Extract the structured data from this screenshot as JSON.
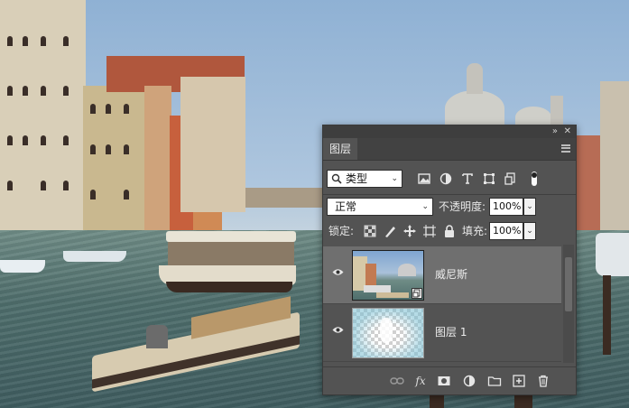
{
  "panel": {
    "collapse_glyph": "»",
    "close_glyph": "✕",
    "tab_label": "图层",
    "filter": {
      "kind_label": "类型",
      "icons": [
        "image-filter-icon",
        "adjustment-filter-icon",
        "type-filter-icon",
        "shape-filter-icon",
        "smart-object-filter-icon"
      ]
    },
    "blend_mode": "正常",
    "opacity_label": "不透明度:",
    "opacity_value": "100%",
    "lock_label": "锁定:",
    "fill_label": "填充:",
    "fill_value": "100%",
    "layers": [
      {
        "name": "威尼斯",
        "visible": true,
        "selected": true,
        "thumbnail": "venice-photo"
      },
      {
        "name": "图层 1",
        "visible": true,
        "selected": false,
        "thumbnail": "transparent-with-mask"
      }
    ],
    "bottom_icons": [
      "link-layers-icon",
      "fx-icon",
      "add-mask-icon",
      "adjustment-layer-icon",
      "new-group-icon",
      "new-layer-icon",
      "delete-layer-icon"
    ],
    "fx_label": "fx"
  },
  "colors": {
    "panel_bg": "#535353",
    "selected_layer": "#6f6f6f",
    "topbar": "#3e3e3e"
  }
}
